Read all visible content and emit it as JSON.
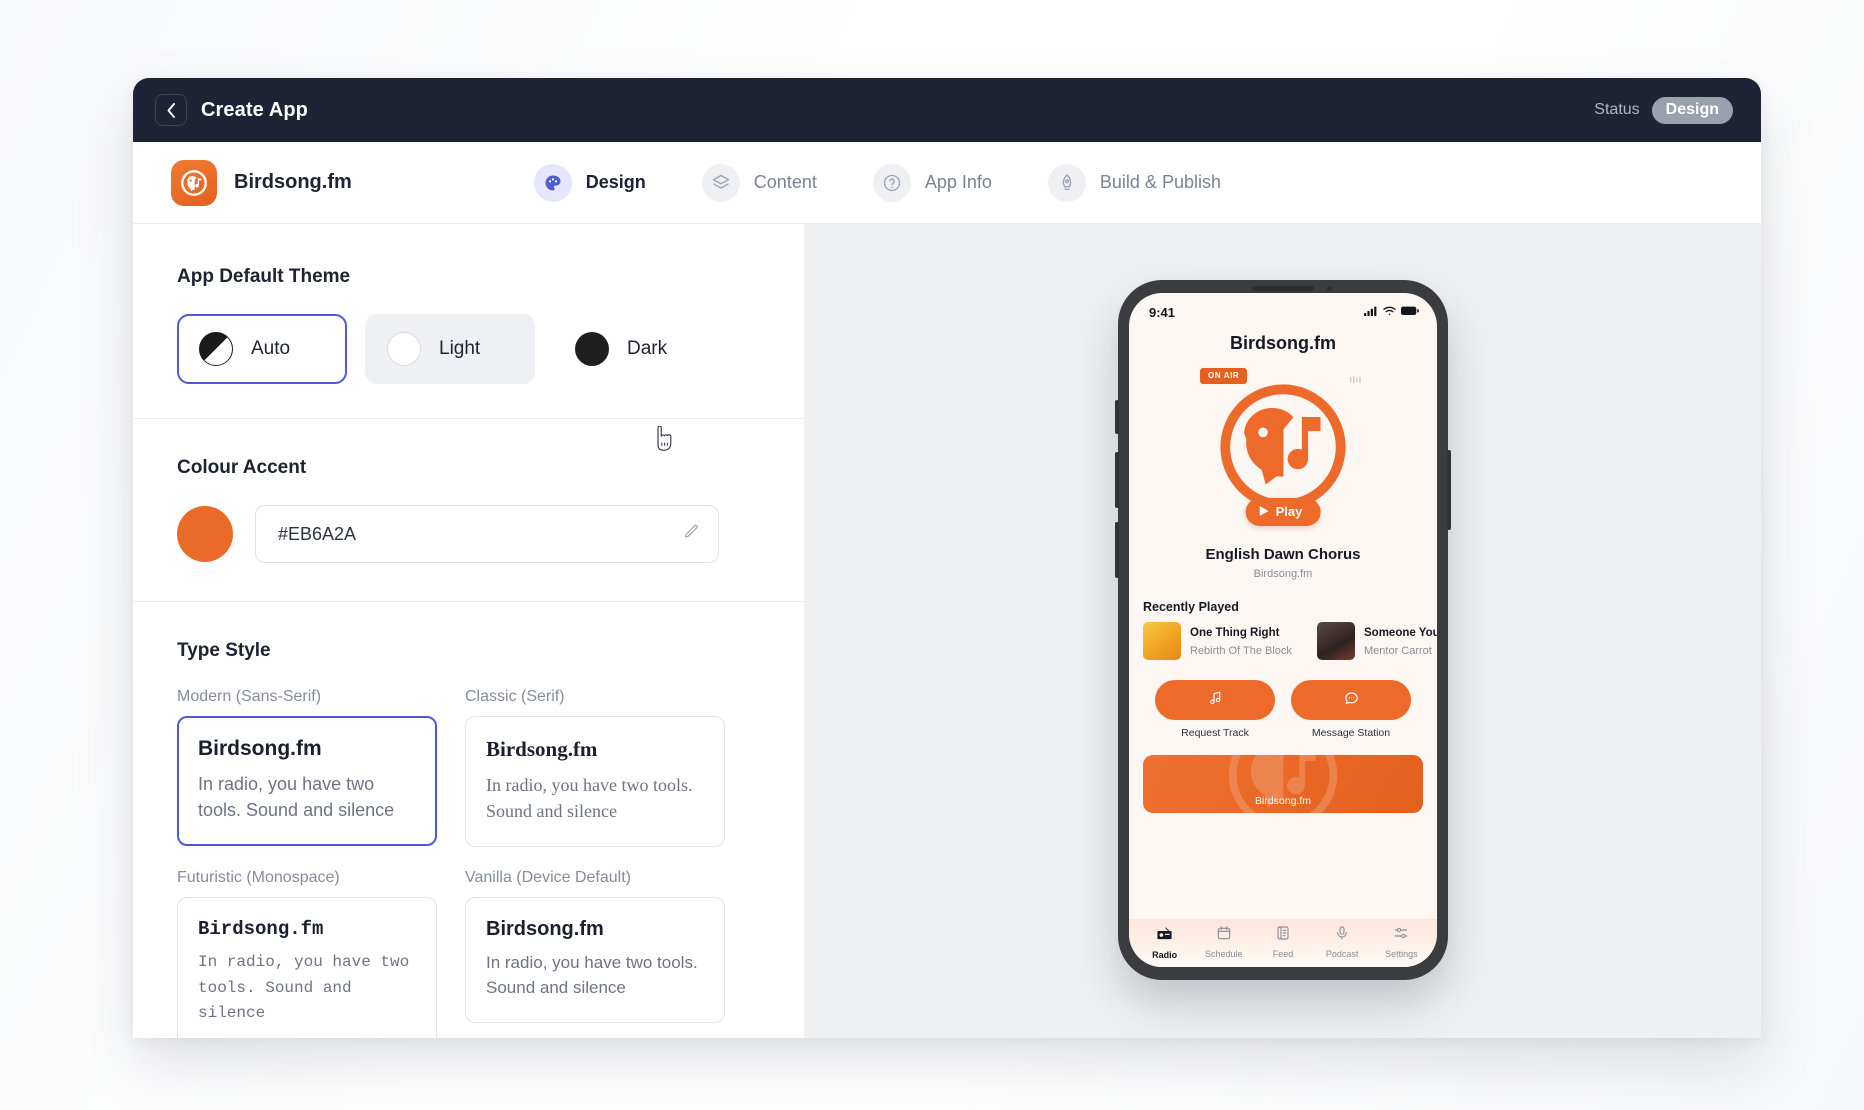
{
  "titlebar": {
    "back_icon": "chevron-left-icon",
    "title": "Create App",
    "status_label": "Status",
    "status_value": "Design"
  },
  "subheader": {
    "brand_name": "Birdsong.fm",
    "brand_logo_icon": "birdsong-logo-icon",
    "tabs": [
      {
        "label": "Design",
        "icon": "palette-icon",
        "active": true
      },
      {
        "label": "Content",
        "icon": "layers-icon",
        "active": false
      },
      {
        "label": "App Info",
        "icon": "question-circle-icon",
        "active": false
      },
      {
        "label": "Build & Publish",
        "icon": "rocket-icon",
        "active": false
      }
    ]
  },
  "theme": {
    "title": "App Default Theme",
    "options": [
      {
        "label": "Auto",
        "state": "selected"
      },
      {
        "label": "Light",
        "state": "hovered"
      },
      {
        "label": "Dark",
        "state": "default"
      }
    ]
  },
  "accent": {
    "title": "Colour Accent",
    "value": "#EB6A2A",
    "color": "#EB6A2A",
    "edit_icon": "pencil-icon"
  },
  "type_style": {
    "title": "Type Style",
    "cards": [
      {
        "caption": "Modern (Sans-Serif)",
        "sample_title": "Birdsong.fm",
        "sample_body": "In radio, you have two tools. Sound and silence",
        "selected": true
      },
      {
        "caption": "Classic (Serif)",
        "sample_title": "Birdsong.fm",
        "sample_body": "In radio, you have two tools. Sound and silence",
        "selected": false
      },
      {
        "caption": "Futuristic (Monospace)",
        "sample_title": "Birdsong.fm",
        "sample_body": "In radio, you have two tools. Sound and silence",
        "selected": false
      },
      {
        "caption": "Vanilla (Device Default)",
        "sample_title": "Birdsong.fm",
        "sample_body": "In radio, you have two tools. Sound and silence",
        "selected": false
      }
    ]
  },
  "preview": {
    "statusbar": {
      "time": "9:41",
      "icons": [
        "signal-icon",
        "wifi-icon",
        "battery-icon"
      ]
    },
    "app_title": "Birdsong.fm",
    "on_air_badge": "ON AIR",
    "more_icon": "more-options-icon",
    "play_label": "Play",
    "play_icon": "play-icon",
    "track_title": "English Dawn Chorus",
    "track_station": "Birdsong.fm",
    "recently_played_heading": "Recently Played",
    "recently_played": [
      {
        "name": "One Thing Right",
        "artist": "Rebirth Of The Block"
      },
      {
        "name": "Someone You Lo",
        "artist": "Mentor Carrot"
      }
    ],
    "actions": [
      {
        "label": "Request Track",
        "icon": "music-note-icon"
      },
      {
        "label": "Message Station",
        "icon": "chat-bubble-icon"
      }
    ],
    "promo_text": "Birdsong.fm",
    "tabbar": [
      {
        "label": "Radio",
        "icon": "radio-icon",
        "active": true
      },
      {
        "label": "Schedule",
        "icon": "calendar-icon",
        "active": false
      },
      {
        "label": "Feed",
        "icon": "feed-list-icon",
        "active": false
      },
      {
        "label": "Podcast",
        "icon": "microphone-icon",
        "active": false
      },
      {
        "label": "Settings",
        "icon": "sliders-icon",
        "active": false
      }
    ]
  }
}
